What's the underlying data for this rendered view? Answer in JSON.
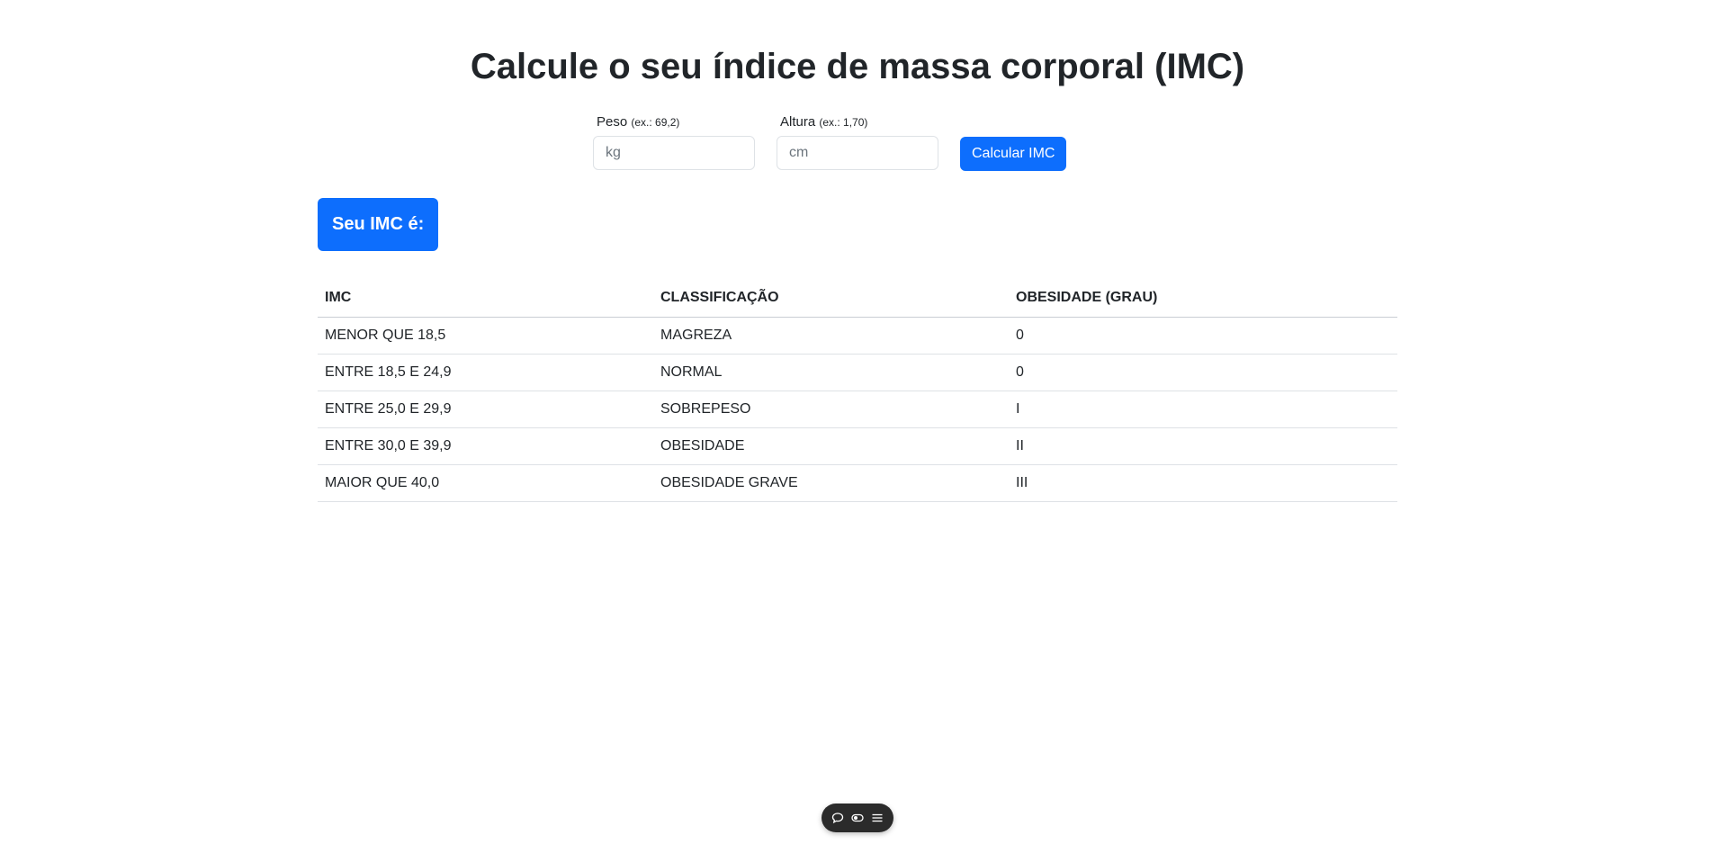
{
  "header": {
    "title": "Calcule o seu índice de massa corporal (IMC)"
  },
  "form": {
    "peso": {
      "label": "Peso",
      "hint": "(ex.: 69,2)",
      "placeholder": "kg",
      "value": ""
    },
    "altura": {
      "label": "Altura",
      "hint": "(ex.: 1,70)",
      "placeholder": "cm",
      "value": ""
    },
    "submit_label": "Calcular IMC"
  },
  "result": {
    "text": "Seu IMC é:"
  },
  "table": {
    "headers": [
      "IMC",
      "CLASSIFICAÇÃO",
      "OBESIDADE (GRAU)"
    ],
    "rows": [
      [
        "MENOR QUE 18,5",
        "MAGREZA",
        "0"
      ],
      [
        "ENTRE 18,5 E 24,9",
        "NORMAL",
        "0"
      ],
      [
        "ENTRE 25,0 E 29,9",
        "SOBREPESO",
        "I"
      ],
      [
        "ENTRE 30,0 E 39,9",
        "OBESIDADE",
        "II"
      ],
      [
        "MAIOR QUE 40,0",
        "OBESIDADE GRAVE",
        "III"
      ]
    ]
  },
  "toolbar": {
    "icons": [
      "comment-icon",
      "toggle-icon",
      "menu-icon"
    ]
  },
  "colors": {
    "primary": "#0d6efd",
    "text": "#212529",
    "border": "#dee2e6",
    "toolbar_bg": "#2b2b2b"
  }
}
